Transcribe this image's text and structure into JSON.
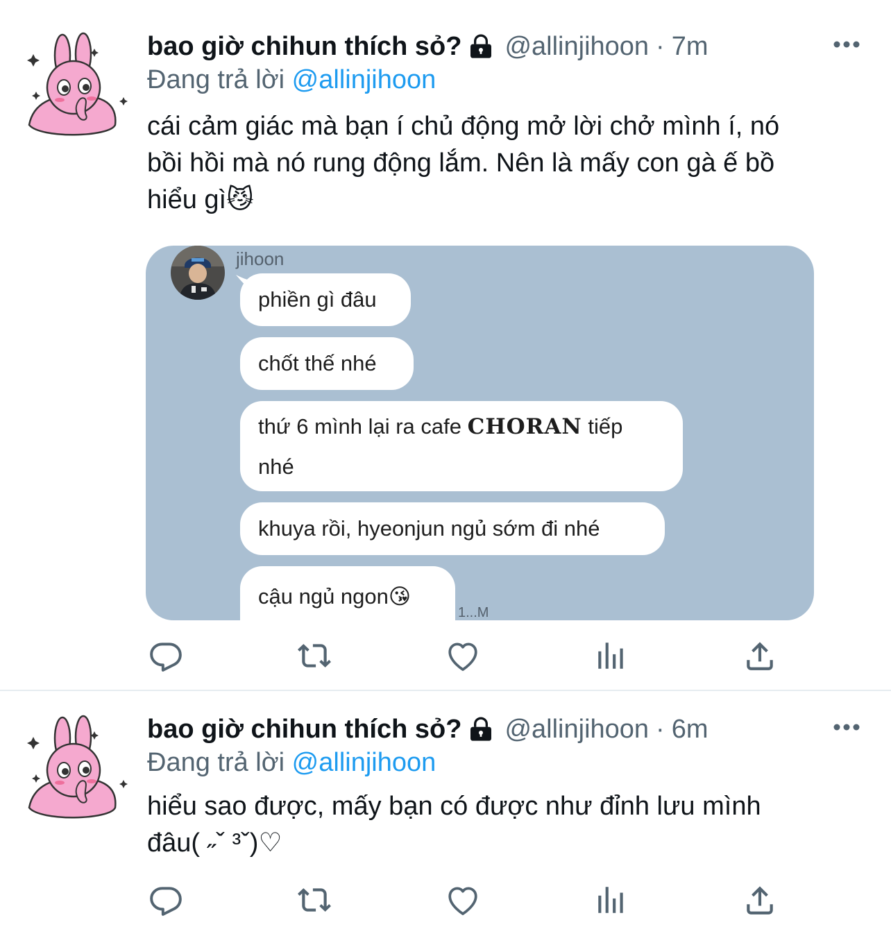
{
  "tweets": [
    {
      "display_name": "bao giờ chihun thích sỏ?",
      "handle": "@allinjihoon",
      "separator": "·",
      "time": "7m",
      "reply_prefix": "Đang trả lời",
      "reply_to": "@allinjihoon",
      "text_lines": [
        "cái cảm giác mà bạn í chủ động mở lời chở mình í, nó",
        "bồi hồi mà nó rung động lắm. Nên là mấy con gà ế bồ",
        "hiểu gì😼"
      ],
      "media": {
        "sender_name": "jihoon",
        "messages": [
          "phiền gì đâu",
          "chốt thế nhé",
          "thứ 6 mình lại ra cafe",
          "CHORAN",
          "tiếp",
          "nhé",
          "khuya rồi, hyeonjun ngủ sớm đi nhé",
          "cậu ngủ ngon😘"
        ],
        "read_time": "1...M"
      }
    },
    {
      "display_name": "bao giờ chihun thích sỏ?",
      "handle": "@allinjihoon",
      "separator": "·",
      "time": "6m",
      "reply_prefix": "Đang trả lời",
      "reply_to": "@allinjihoon",
      "text_lines": [
        "hiểu sao được, mấy bạn có được như đỉnh lưu mình",
        "đâu( ˶ˇ ³ˇ)♡"
      ]
    }
  ],
  "colors": {
    "text": "#0f1419",
    "secondary": "#536471",
    "link": "#1d9bf0",
    "chat_background": "#aabfd2",
    "divider": "#e6ecf0"
  },
  "icons": [
    "lock-icon",
    "more-icon",
    "reply-icon",
    "retweet-icon",
    "like-icon",
    "analytics-icon",
    "share-icon"
  ]
}
